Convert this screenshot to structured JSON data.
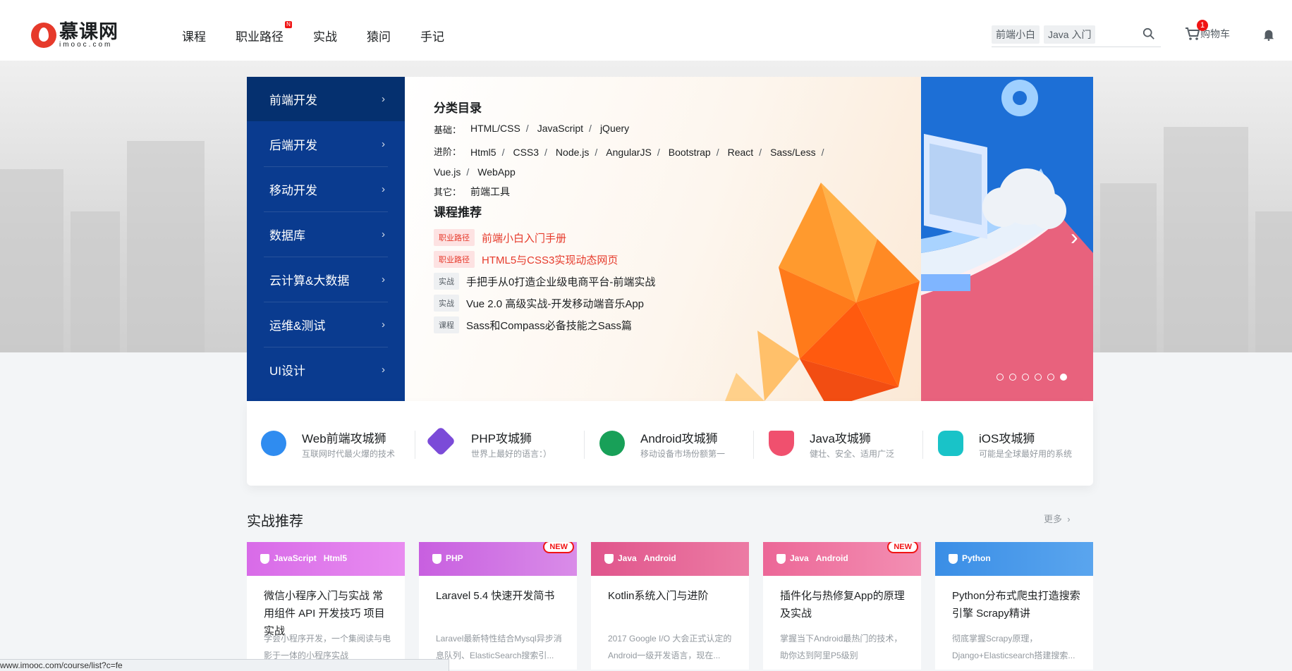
{
  "header": {
    "logo_cn": "慕课网",
    "logo_en": "imooc.com",
    "nav": [
      {
        "label": "课程"
      },
      {
        "label": "职业路径",
        "badge": "N"
      },
      {
        "label": "实战"
      },
      {
        "label": "猿问"
      },
      {
        "label": "手记"
      }
    ],
    "search_tags": [
      "前端小白",
      "Java 入门"
    ],
    "cart_label": "购物车",
    "cart_count": "1"
  },
  "categories": [
    {
      "label": "前端开发",
      "active": true
    },
    {
      "label": "后端开发"
    },
    {
      "label": "移动开发"
    },
    {
      "label": "数据库"
    },
    {
      "label": "云计算&大数据"
    },
    {
      "label": "运维&测试"
    },
    {
      "label": "UI设计"
    }
  ],
  "panel": {
    "directory_title": "分类目录",
    "rows": [
      {
        "label": "基础：",
        "links": [
          "HTML/CSS",
          "JavaScript",
          "jQuery"
        ]
      },
      {
        "label": "进阶：",
        "links": [
          "Html5",
          "CSS3",
          "Node.js",
          "AngularJS",
          "Bootstrap",
          "React",
          "Sass/Less",
          "Vue.js",
          "WebApp"
        ]
      },
      {
        "label": "其它：",
        "links": [
          "前端工具"
        ]
      }
    ],
    "recommend_title": "课程推荐",
    "recommendations": [
      {
        "tag": "职业路径",
        "title": "前端小白入门手册",
        "highlight": true
      },
      {
        "tag": "职业路径",
        "title": "HTML5与CSS3实现动态网页",
        "highlight": true
      },
      {
        "tag": "实战",
        "title": "手把手从0打造企业级电商平台-前端实战",
        "highlight": false
      },
      {
        "tag": "实战",
        "title": "Vue 2.0 高级实战-开发移动端音乐App",
        "highlight": false
      },
      {
        "tag": "课程",
        "title": "Sass和Compass必备技能之Sass篇",
        "highlight": false
      }
    ]
  },
  "paths": [
    {
      "title": "Web前端攻城狮",
      "desc": "互联网时代最火爆的技术",
      "color": "#2f8cf0"
    },
    {
      "title": "PHP攻城狮",
      "desc": "世界上最好的语言：）",
      "color": "#7b4bd8"
    },
    {
      "title": "Android攻城狮",
      "desc": "移动设备市场份额第一",
      "color": "#18a058"
    },
    {
      "title": "Java攻城狮",
      "desc": "健壮、安全、适用广泛",
      "color": "#f0506e"
    },
    {
      "title": "iOS攻城狮",
      "desc": "可能是全球最好用的系统",
      "color": "#19c3c8"
    }
  ],
  "section": {
    "title": "实战推荐",
    "more": "更多"
  },
  "cards": [
    {
      "tags": [
        "JavaScript",
        "Html5"
      ],
      "title": "微信小程序入门与实战 常用组件 API 开发技巧 项目实战",
      "desc": "学会小程序开发，一个集阅读与电影于一体的小程序实战",
      "new": false,
      "color": "#d86be8"
    },
    {
      "tags": [
        "PHP"
      ],
      "title": "Laravel 5.4 快速开发简书",
      "desc": "Laravel最新特性结合Mysql异步消息队列、ElasticSearch搜索引...",
      "new": true,
      "new_label": "NEW",
      "color": "#c85fe0"
    },
    {
      "tags": [
        "Java",
        "Android"
      ],
      "title": "Kotlin系统入门与进阶",
      "desc": "2017 Google I/O 大会正式认定的Android一级开发语言，现在...",
      "new": false,
      "color": "#e0558c"
    },
    {
      "tags": [
        "Java",
        "Android"
      ],
      "title": "插件化与热修复App的原理及实战",
      "desc": "掌握当下Android最热门的技术，助你达到阿里P5级别",
      "new": true,
      "new_label": "NEW",
      "color": "#ec6797"
    },
    {
      "tags": [
        "Python"
      ],
      "title": "Python分布式爬虫打造搜索引擎 Scrapy精讲",
      "desc": "彻底掌握Scrapy原理，Django+Elasticsearch搭建搜索...",
      "new": false,
      "color": "#3a8ee6"
    }
  ],
  "status_url": "www.imooc.com/course/list?c=fe"
}
